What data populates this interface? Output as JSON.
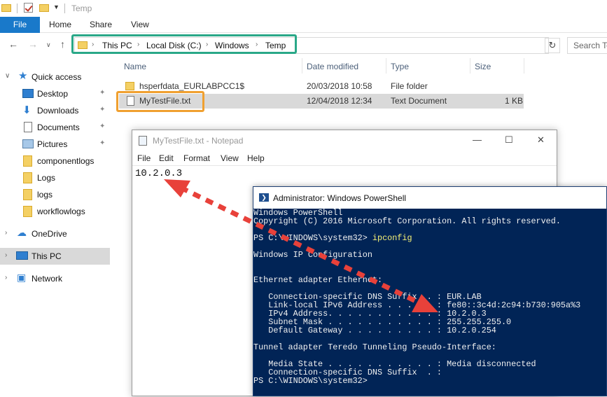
{
  "explorer": {
    "title": "Temp",
    "ribbon": {
      "tabs": [
        "File",
        "Home",
        "Share",
        "View"
      ]
    },
    "address": {
      "breadcrumbs": [
        "This PC",
        "Local Disk (C:)",
        "Windows",
        "Temp"
      ]
    },
    "search": {
      "placeholder": "Search Temp"
    },
    "nav": {
      "quick_access": "Quick access",
      "items": [
        "Desktop",
        "Downloads",
        "Documents",
        "Pictures",
        "componentlogs",
        "Logs",
        "logs",
        "workflowlogs"
      ],
      "onedrive": "OneDrive",
      "this_pc": "This PC",
      "network": "Network"
    },
    "columns": [
      "Name",
      "Date modified",
      "Type",
      "Size"
    ],
    "files": [
      {
        "name": "hsperfdata_EURLABPCC1$",
        "date": "20/03/2018 10:58",
        "type": "File folder",
        "size": ""
      },
      {
        "name": "MyTestFile.txt",
        "date": "12/04/2018 12:34",
        "type": "Text Document",
        "size": "1 KB"
      }
    ]
  },
  "notepad": {
    "title": "MyTestFile.txt - Notepad",
    "menu": [
      "File",
      "Edit",
      "Format",
      "View",
      "Help"
    ],
    "content": "10.2.0.3"
  },
  "powershell": {
    "title": "Administrator: Windows PowerShell",
    "lines": [
      {
        "text": "Windows PowerShell",
        "cmd": ""
      },
      {
        "text": "Copyright (C) 2016 Microsoft Corporation. All rights reserved.",
        "cmd": ""
      },
      {
        "text": "",
        "cmd": ""
      },
      {
        "text": "PS C:\\WINDOWS\\system32> ",
        "cmd": "ipconfig"
      },
      {
        "text": "",
        "cmd": ""
      },
      {
        "text": "Windows IP Configuration",
        "cmd": ""
      },
      {
        "text": "",
        "cmd": ""
      },
      {
        "text": "",
        "cmd": ""
      },
      {
        "text": "Ethernet adapter Ethernet:",
        "cmd": ""
      },
      {
        "text": "",
        "cmd": ""
      },
      {
        "text": "   Connection-specific DNS Suffix  . : EUR.LAB",
        "cmd": ""
      },
      {
        "text": "   Link-local IPv6 Address . . . . . : fe80::3c4d:2c94:b730:905a%3",
        "cmd": ""
      },
      {
        "text": "   IPv4 Address. . . . . . . . . . . : 10.2.0.3",
        "cmd": ""
      },
      {
        "text": "   Subnet Mask . . . . . . . . . . . : 255.255.255.0",
        "cmd": ""
      },
      {
        "text": "   Default Gateway . . . . . . . . . : 10.2.0.254",
        "cmd": ""
      },
      {
        "text": "",
        "cmd": ""
      },
      {
        "text": "Tunnel adapter Teredo Tunneling Pseudo-Interface:",
        "cmd": ""
      },
      {
        "text": "",
        "cmd": ""
      },
      {
        "text": "   Media State . . . . . . . . . . . : Media disconnected",
        "cmd": ""
      },
      {
        "text": "   Connection-specific DNS Suffix  . :",
        "cmd": ""
      },
      {
        "text": "PS C:\\WINDOWS\\system32>",
        "cmd": ""
      }
    ]
  },
  "colors": {
    "ribbon_file": "#1979ca",
    "powershell_bg": "#012456",
    "highlight_address": "#2aa888",
    "highlight_file": "#f0a030",
    "arrow": "#e8413a"
  }
}
